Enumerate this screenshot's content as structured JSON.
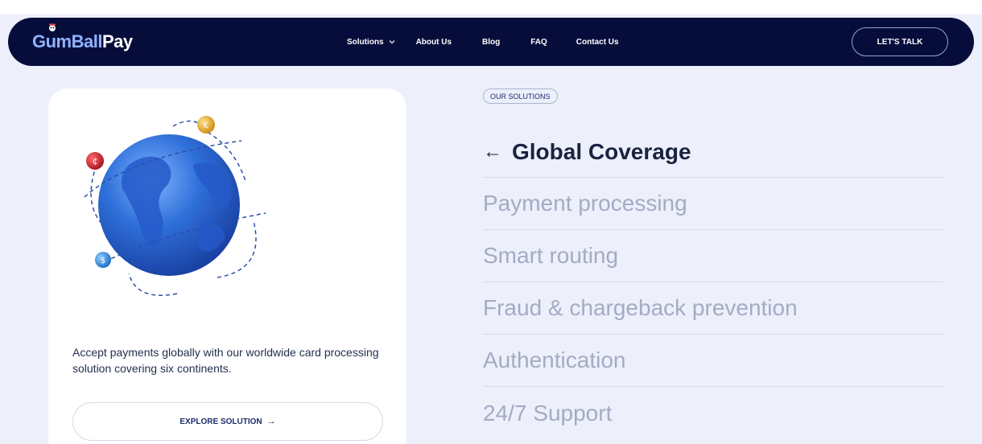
{
  "brand": {
    "logo_part1": "Gum",
    "logo_part2": "Ball",
    "logo_part3": "Pay"
  },
  "nav": {
    "links": [
      {
        "label": "Solutions",
        "icon": "chevron-down-icon"
      },
      {
        "label": "About Us"
      },
      {
        "label": "Blog"
      },
      {
        "label": "FAQ"
      },
      {
        "label": "Contact Us"
      }
    ],
    "cta_label": "LET'S TALK"
  },
  "card": {
    "description": "Accept payments globally with our worldwide card processing solution covering six continents.",
    "button_label": "EXPLORE SOLUTION",
    "button_icon": "arrow-right-icon"
  },
  "solutions": {
    "tag": "OUR SOLUTIONS",
    "items": [
      {
        "label": "Global Coverage",
        "active": true,
        "icon": "arrow-left-icon"
      },
      {
        "label": "Payment processing"
      },
      {
        "label": "Smart routing"
      },
      {
        "label": "Fraud & chargeback prevention"
      },
      {
        "label": "Authentication"
      },
      {
        "label": "24/7 Support"
      }
    ]
  },
  "colors": {
    "navbar": "#070d3b",
    "page_bg": "#edf0fb",
    "active_text": "#1a2340",
    "inactive_text": "#a4abc3",
    "globe_blue": "#2f6fd9"
  }
}
